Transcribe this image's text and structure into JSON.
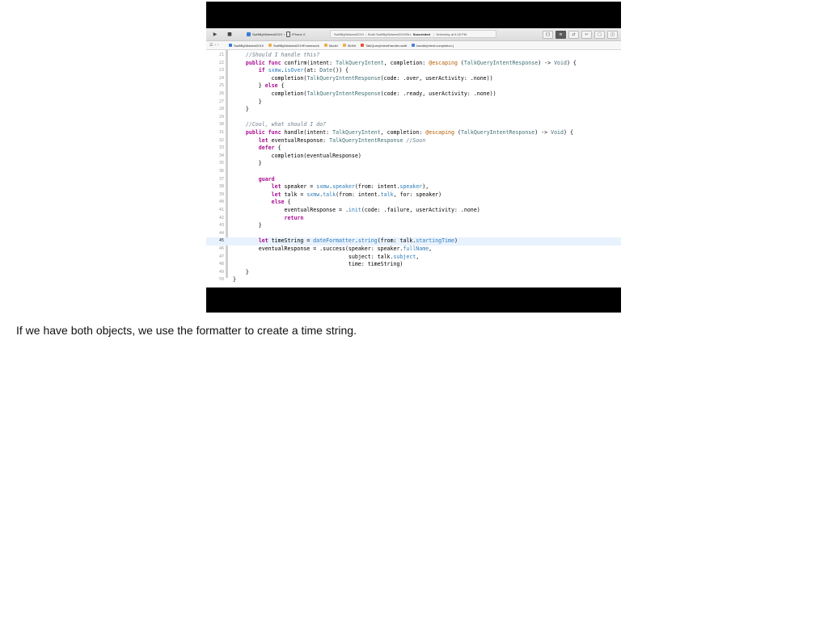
{
  "toolbar": {
    "run_icon": "play-icon",
    "stop_icon": "stop-square-icon",
    "scheme_name": "SwiftByMidwest2019",
    "device": "iPhone X",
    "status_project": "SwiftByMidwest2019",
    "status_action": "Build SwiftByMidwest2019Siri:",
    "status_result": "Succeeded",
    "status_time": "Yesterday at 6:45 PM",
    "right_buttons": [
      "{}",
      "≡",
      "⇄",
      "↩",
      "□",
      "◫"
    ]
  },
  "jumpbar": {
    "nav": "☰ ‹ ›",
    "crumbs": [
      {
        "label": "SwiftByMidwest2019",
        "icon": "project-icon"
      },
      {
        "label": "SwiftByMidwest2019Framework",
        "icon": "folder-icon"
      },
      {
        "label": "Model",
        "icon": "folder-icon"
      },
      {
        "label": "SiriKit",
        "icon": "folder-icon"
      },
      {
        "label": "TalkQueryIntentHandler.swift",
        "icon": "swift-file-icon"
      },
      {
        "label": "handle(intent:completion:)",
        "icon": "method-icon"
      }
    ]
  },
  "editor": {
    "current_line": "45",
    "lines": [
      {
        "n": "21",
        "code": "    //Should I handle this?"
      },
      {
        "n": "22",
        "code": "    public func confirm(intent: TalkQueryIntent, completion: @escaping (TalkQueryIntentResponse) -> Void) {"
      },
      {
        "n": "23",
        "code": "        if sxmw.isOver(at: Date()) {"
      },
      {
        "n": "24",
        "code": "            completion(TalkQueryIntentResponse(code: .over, userActivity: .none))"
      },
      {
        "n": "25",
        "code": "        } else {"
      },
      {
        "n": "26",
        "code": "            completion(TalkQueryIntentResponse(code: .ready, userActivity: .none))"
      },
      {
        "n": "27",
        "code": "        }"
      },
      {
        "n": "28",
        "code": "    }"
      },
      {
        "n": "29",
        "code": ""
      },
      {
        "n": "30",
        "code": "    //Cool, what should I do?"
      },
      {
        "n": "31",
        "code": "    public func handle(intent: TalkQueryIntent, completion: @escaping (TalkQueryIntentResponse) -> Void) {"
      },
      {
        "n": "32",
        "code": "        let eventualResponse: TalkQueryIntentResponse //Soon"
      },
      {
        "n": "33",
        "code": "        defer {"
      },
      {
        "n": "34",
        "code": "            completion(eventualResponse)"
      },
      {
        "n": "35",
        "code": "        }"
      },
      {
        "n": "36",
        "code": ""
      },
      {
        "n": "37",
        "code": "        guard"
      },
      {
        "n": "38",
        "code": "            let speaker = sxmw.speaker(from: intent.speaker),"
      },
      {
        "n": "39",
        "code": "            let talk = sxmw.talk(from: intent.talk, for: speaker)"
      },
      {
        "n": "40",
        "code": "            else {"
      },
      {
        "n": "41",
        "code": "                eventualResponse = .init(code: .failure, userActivity: .none)"
      },
      {
        "n": "42",
        "code": "                return"
      },
      {
        "n": "43",
        "code": "        }"
      },
      {
        "n": "44",
        "code": ""
      },
      {
        "n": "45",
        "code": "        let timeString = dateFormatter.string(from: talk.startingTime)"
      },
      {
        "n": "46",
        "code": "        eventualResponse = .success(speaker: speaker.fullName,"
      },
      {
        "n": "47",
        "code": "                                    subject: talk.subject,"
      },
      {
        "n": "48",
        "code": "                                    time: timeString)"
      },
      {
        "n": "49",
        "code": "    }"
      },
      {
        "n": "50",
        "code": "}"
      }
    ]
  },
  "caption": "If we have both objects, we use the formatter to create a time string."
}
